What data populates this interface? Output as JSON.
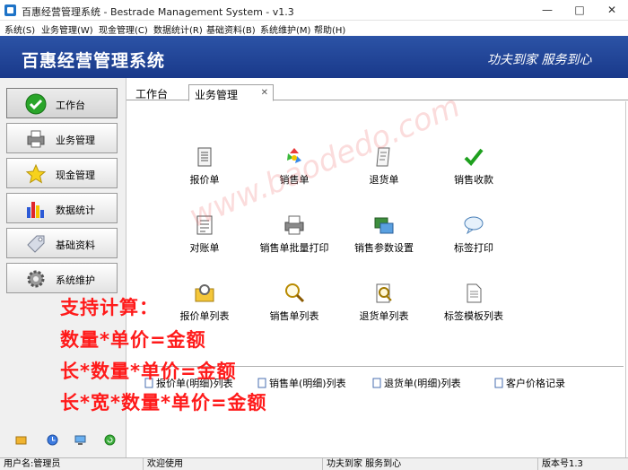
{
  "window": {
    "title": "百惠经营管理系统 - Bestrade Management System - v1.3"
  },
  "menu": [
    "系统(S)",
    "业务管理(W)",
    "现金管理(C)",
    "数据统计(R)",
    "基础资料(B)",
    "系统维护(M)",
    "帮助(H)"
  ],
  "banner": {
    "title": "百惠经营管理系统",
    "slogan": "功夫到家 服务到心"
  },
  "sidebar": [
    {
      "label": "工作台",
      "icon": "check-icon"
    },
    {
      "label": "业务管理",
      "icon": "printer-icon"
    },
    {
      "label": "现金管理",
      "icon": "star-icon"
    },
    {
      "label": "数据统计",
      "icon": "bar-chart-icon"
    },
    {
      "label": "基础资料",
      "icon": "tag-icon"
    },
    {
      "label": "系统维护",
      "icon": "gear-icon"
    }
  ],
  "tabs": [
    {
      "label": "工作台"
    },
    {
      "label": "业务管理"
    }
  ],
  "features": [
    "报价单",
    "销售单",
    "退货单",
    "销售收款",
    "对账单",
    "销售单批量打印",
    "销售参数设置",
    "标签打印",
    "报价单列表",
    "销售单列表",
    "退货单列表",
    "标签模板列表"
  ],
  "quick_links": [
    "报价单(明细)列表",
    "销售单(明细)列表",
    "退货单(明细)列表",
    "客户价格记录"
  ],
  "overlay": [
    "支持计算：",
    "数量*单价=金额",
    "长*数量*单价=金额",
    "长*宽*数量*单价=金额"
  ],
  "watermark": "www.baodedo.com",
  "status": {
    "user": "用户名:管理员",
    "welcome": "欢迎使用",
    "slogan": "功夫到家 服务到心",
    "version": "版本号1.3"
  },
  "colors": {
    "banner": "#1f4596",
    "overlay_text": "#ff1a1a",
    "accent_check": "#2aa52a"
  }
}
